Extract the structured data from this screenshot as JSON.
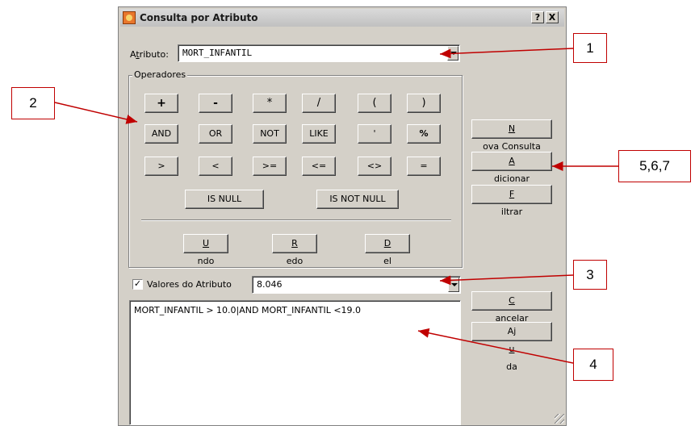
{
  "window": {
    "title": "Consulta por Atributo",
    "help_btn": "?",
    "close_btn": "X"
  },
  "attribute": {
    "label_pre": "A",
    "label_u": "t",
    "label_post": "ributo:",
    "value": "MORT_INFANTIL"
  },
  "operators": {
    "group_label": "Operadores",
    "row1": [
      "+",
      "-",
      "*",
      "/",
      "(",
      ")"
    ],
    "row2": [
      "AND",
      "OR",
      "NOT",
      "LIKE",
      "'",
      "%"
    ],
    "row3": [
      ">",
      "<",
      ">=",
      "<=",
      "<>",
      "="
    ],
    "is_null": "IS NULL",
    "is_not_null": "IS NOT NULL",
    "undo": {
      "u": "U",
      "rest": "ndo"
    },
    "redo": {
      "u": "R",
      "rest": "edo"
    },
    "del": {
      "u": "D",
      "rest": "el"
    }
  },
  "side_buttons": {
    "nova_consulta": {
      "u": "N",
      "rest": "ova Consulta"
    },
    "adicionar": {
      "u": "A",
      "rest": "dicionar"
    },
    "filtrar": {
      "u": "F",
      "rest": "iltrar"
    },
    "cancelar": {
      "u": "C",
      "rest": "ancelar"
    },
    "ajuda": {
      "pre": "Aj",
      "u": "u",
      "rest": "da"
    }
  },
  "valores": {
    "checked": true,
    "check_mark": "✓",
    "label": "Valores do Atributo",
    "value": "8.046"
  },
  "query_text": "MORT_INFANTIL > 10.0|AND MORT_INFANTIL <19.0",
  "callouts": {
    "c1": "1",
    "c2": "2",
    "c3": "3",
    "c4": "4",
    "c5": "5,6,7"
  },
  "colors": {
    "annotation": "#c00000",
    "dialog_face": "#d4d0c8"
  }
}
